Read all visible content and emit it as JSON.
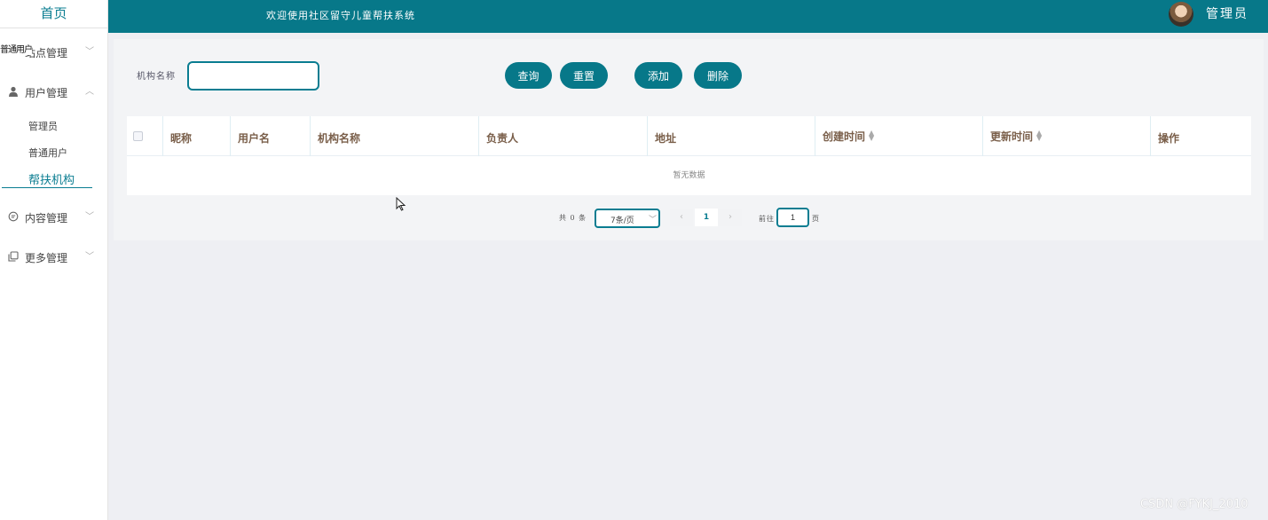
{
  "sidebar": {
    "home": "首页",
    "tooltip": "普通用户",
    "menus": [
      {
        "label": "站点管理",
        "icon": "gear-icon"
      },
      {
        "label": "用户管理",
        "icon": "user-icon"
      },
      {
        "label": "内容管理",
        "icon": "chat-icon"
      },
      {
        "label": "更多管理",
        "icon": "copy-icon"
      }
    ],
    "user_sub": [
      "管理员",
      "普通用户",
      "帮扶机构"
    ]
  },
  "header": {
    "title": "欢迎使用社区留守儿童帮扶系统",
    "user": "管理员"
  },
  "search": {
    "label": "机构名称",
    "value": "",
    "buttons": {
      "query": "查询",
      "reset": "重置",
      "add": "添加",
      "delete": "删除"
    }
  },
  "table": {
    "columns": [
      "昵称",
      "用户名",
      "机构名称",
      "负责人",
      "地址",
      "创建时间",
      "更新时间",
      "操作"
    ],
    "empty_text": "暂无数据",
    "rows": []
  },
  "pagination": {
    "total": "共 0 条",
    "page_size": "7条/页",
    "current_page": "1",
    "goto_label": "前往",
    "goto_value": "1",
    "page_suffix": "页"
  },
  "watermark": "CSDN @FYKJ_2010",
  "colors": {
    "primary": "#077889",
    "background": "#eeeff3"
  }
}
